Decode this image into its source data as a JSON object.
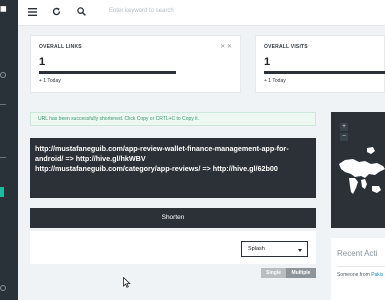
{
  "search": {
    "placeholder": "Enter keyword to search"
  },
  "stats": {
    "links": {
      "label": "OVERALL LINKS",
      "value": "1",
      "today": "+ 1 Today",
      "tools": "✕ ✕",
      "progress": 0.6
    },
    "visits": {
      "label": "OVERALL VISITS",
      "value": "1",
      "today": "+ 1 Today",
      "progress": 0.6
    }
  },
  "alert": {
    "message": "URL has been successfully shortened. Click Copy or CRTL+C to Copy it."
  },
  "shortened": {
    "text": "http://mustafaneguib.com/app-review-wallet-finance-management-app-for-android/ => http://hive.gl/hkWBV\nhttp://mustafaneguib.com/category/app-reviews/ => http://hive.gl/62b00"
  },
  "shorten_button": {
    "label": "Shorten"
  },
  "redirect_select": {
    "value": "Splash"
  },
  "mode_toggle": {
    "single": "Single",
    "multiple": "Multiple",
    "active": "Multiple"
  },
  "map": {
    "zoom_in": "+",
    "zoom_out": "−"
  },
  "recent": {
    "title": "Recent Acti",
    "item_prefix": "Someone from",
    "item_place": "Pakis"
  },
  "colors": {
    "dark": "#2b3137",
    "accent": "#1abc9c",
    "alert_text": "#3a9a6e",
    "link": "#1a8fb7"
  },
  "icons": [
    "hamburger-menu-icon",
    "refresh-icon",
    "search-icon",
    "cursor-icon"
  ]
}
